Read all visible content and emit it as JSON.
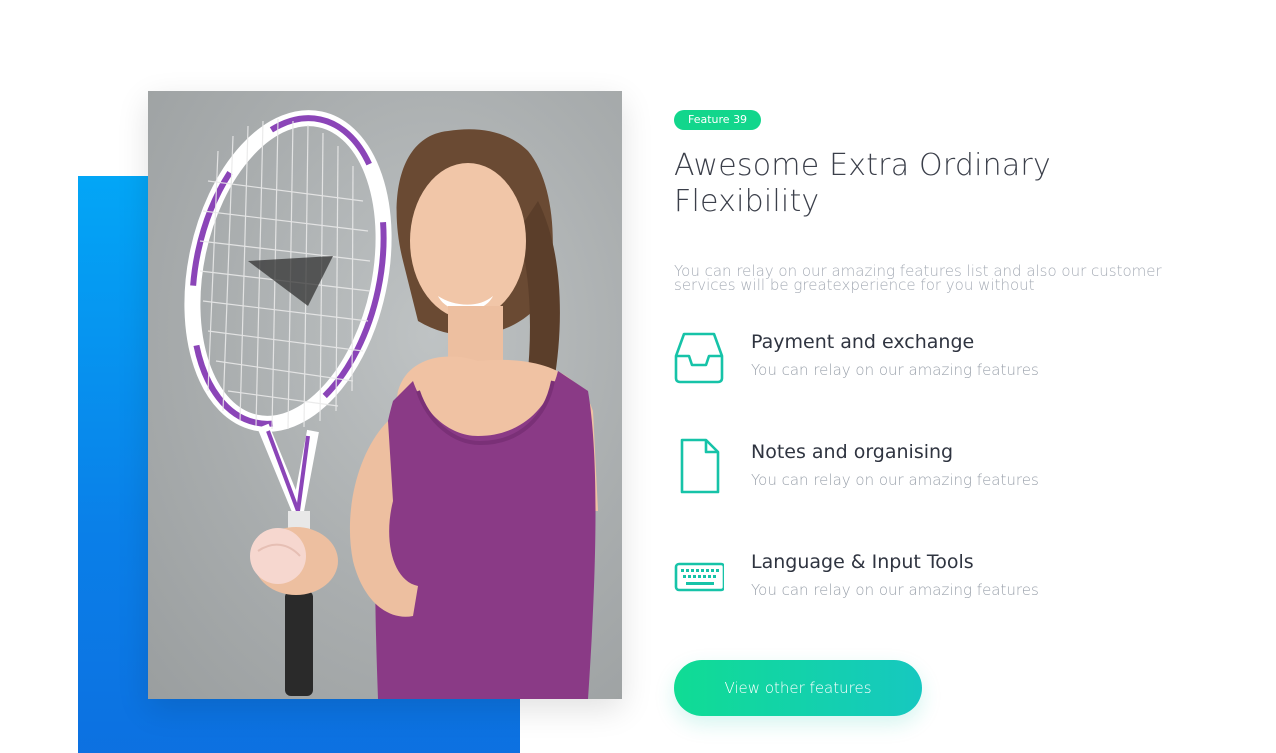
{
  "feature_section": {
    "badge": "Feature 39",
    "title": "Awesome Extra Ordinary Flexibility",
    "description": "You can relay on our amazing features list and also our customer services will be greatexperience for you without",
    "items": [
      {
        "icon": "inbox-icon",
        "title": "Payment and exchange",
        "description": "You can relay on our amazing features"
      },
      {
        "icon": "document-icon",
        "title": "Notes and organising",
        "description": "You can relay on our amazing features"
      },
      {
        "icon": "keyboard-icon",
        "title": "Language & Input Tools",
        "description": "You can relay on our amazing features"
      }
    ],
    "cta_label": "View other features"
  },
  "colors": {
    "accent_green": "#12d68c",
    "icon_teal": "#16c3a8",
    "blue_block": "#0a7fe8",
    "title_text": "#3b3f4a",
    "muted_text": "#9aa1ab"
  }
}
